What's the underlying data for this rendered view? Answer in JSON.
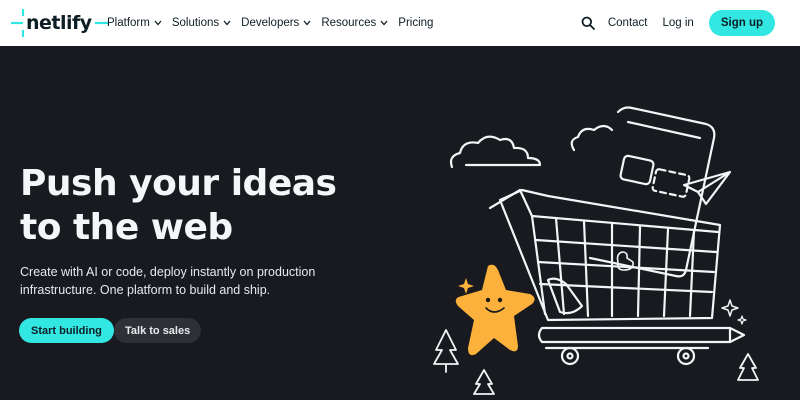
{
  "brand": {
    "name": "netlify",
    "accent": "#32e6e2",
    "dark": "#181a1f"
  },
  "nav": {
    "items": [
      {
        "label": "Platform",
        "has_dropdown": true
      },
      {
        "label": "Solutions",
        "has_dropdown": true
      },
      {
        "label": "Developers",
        "has_dropdown": true
      },
      {
        "label": "Resources",
        "has_dropdown": true
      },
      {
        "label": "Pricing",
        "has_dropdown": false
      }
    ],
    "search_icon": "search-icon",
    "contact_label": "Contact",
    "login_label": "Log in",
    "signup_label": "Sign up"
  },
  "hero": {
    "title_line1": "Push your ideas",
    "title_line2": "to the web",
    "subtitle_line1": "Create with AI or code, deploy instantly on production",
    "subtitle_line2": "infrastructure. One platform to build and ship.",
    "primary_cta": "Start building",
    "secondary_cta": "Talk to sales"
  },
  "illustration": {
    "icons": [
      "cloud-icon",
      "phone-icon",
      "paper-plane-icon",
      "shopping-cart-icon",
      "star-mascot-icon",
      "pine-tree-icon",
      "sparkle-icon",
      "duck-icon",
      "pencil-icon"
    ]
  }
}
